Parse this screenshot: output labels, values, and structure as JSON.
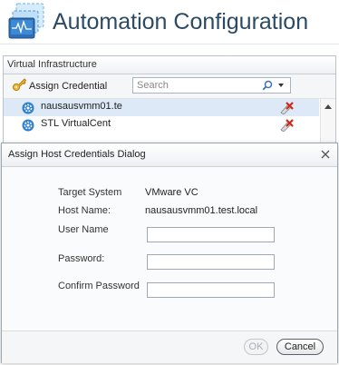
{
  "header": {
    "title": "Automation Configuration"
  },
  "panel": {
    "title": "Virtual Infrastructure",
    "toolbar": {
      "assign_label": "Assign Credential",
      "search_placeholder": "Search"
    },
    "rows": [
      {
        "label": "nausausvmm01.te",
        "selected": true
      },
      {
        "label": "STL VirtualCent",
        "selected": false
      }
    ]
  },
  "dialog": {
    "title": "Assign Host Credentials Dialog",
    "fields": {
      "target_system": {
        "label": "Target System",
        "value": "VMware VC"
      },
      "host_name": {
        "label": "Host Name:",
        "value": "nausausvmm01.test.local"
      },
      "user_name": {
        "label": "User Name",
        "value": ""
      },
      "password": {
        "label": "Password:",
        "value": ""
      },
      "confirm_password": {
        "label": "Confirm Password",
        "value": ""
      }
    },
    "buttons": {
      "ok": "OK",
      "cancel": "Cancel"
    }
  }
}
